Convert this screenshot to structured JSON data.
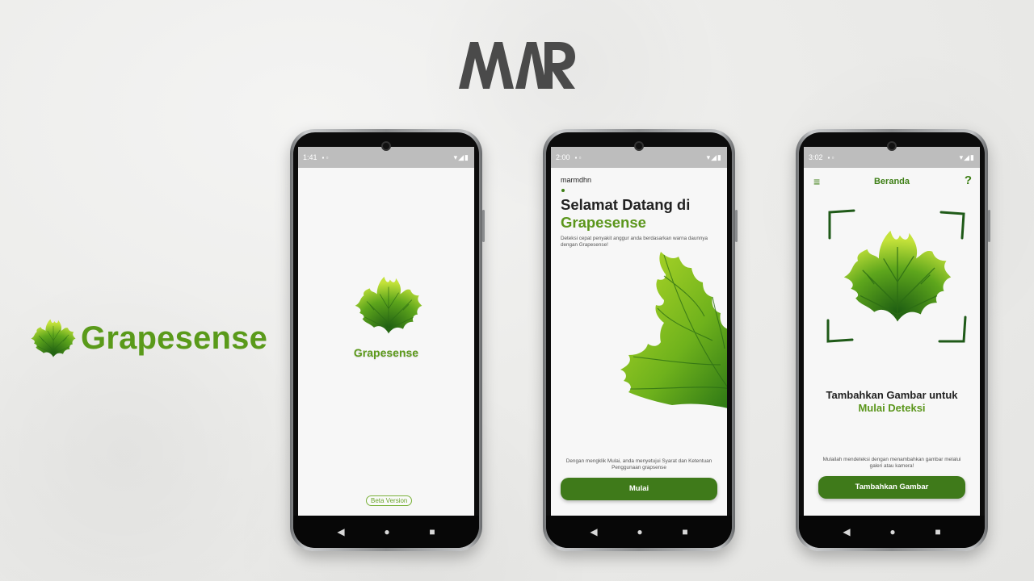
{
  "brand": {
    "logo_text": "MAR",
    "app_name": "Grapesense",
    "accent_color": "#5a9a1a",
    "primary_button_color": "#3f7a1a"
  },
  "phone1": {
    "status": {
      "time": "1:41"
    },
    "splash_title": "Grapesense",
    "beta_label": "Beta Version"
  },
  "phone2": {
    "status": {
      "time": "2:00"
    },
    "username": "marmdhn",
    "heading_line1": "Selamat Datang di",
    "heading_line2": "Grapesense",
    "description": "Deteksi cepat penyakit anggur anda berdasarkan warna daunnya dengan Grapesense!",
    "terms": "Dengan mengklik Mulai, anda menyetujui Syarat dan Ketentuan Penggunaan grapsense",
    "start_button": "Mulai"
  },
  "phone3": {
    "status": {
      "time": "3:02"
    },
    "menu_icon": "menu-icon",
    "title": "Beranda",
    "help_label": "?",
    "heading_line1": "Tambahkan Gambar untuk",
    "heading_line2": "Mulai Deteksi",
    "note": "Mulailah mendeteksi dengan menambahkan gambar melalui galeri atau kamera!",
    "add_button": "Tambahkan Gambar"
  },
  "navbar": {
    "back": "◀",
    "home": "●",
    "recents": "■"
  }
}
